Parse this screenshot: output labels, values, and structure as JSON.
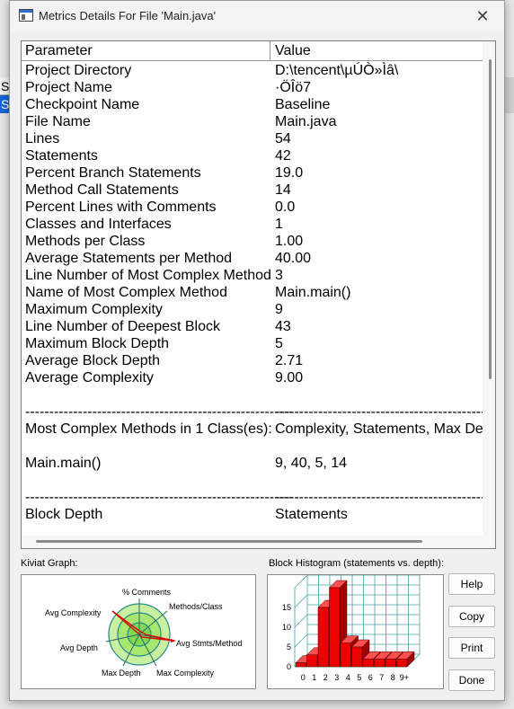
{
  "background_app": {
    "fragment_top": "Si",
    "fragment_selected": "S"
  },
  "window": {
    "title": "Metrics Details For File 'Main.java'",
    "close_glyph": "✕"
  },
  "table": {
    "headers": [
      "Parameter",
      "Value"
    ],
    "rows": [
      {
        "param": "Project Directory",
        "value": "D:\\tencent\\µÚÒ»Ìâ\\"
      },
      {
        "param": "Project Name",
        "value": "·ÖÎö7"
      },
      {
        "param": "Checkpoint Name",
        "value": "Baseline"
      },
      {
        "param": "File Name",
        "value": "Main.java"
      },
      {
        "param": "Lines",
        "value": "54"
      },
      {
        "param": "Statements",
        "value": "42"
      },
      {
        "param": "Percent Branch Statements",
        "value": "19.0"
      },
      {
        "param": "Method Call Statements",
        "value": "14"
      },
      {
        "param": "Percent Lines with Comments",
        "value": "0.0"
      },
      {
        "param": "Classes and Interfaces",
        "value": "1"
      },
      {
        "param": "Methods per Class",
        "value": "1.00"
      },
      {
        "param": "Average Statements per Method",
        "value": "40.00"
      },
      {
        "param": "Line Number of Most Complex Method",
        "value": "3"
      },
      {
        "param": "Name of Most Complex Method",
        "value": "Main.main()"
      },
      {
        "param": "Maximum Complexity",
        "value": "9"
      },
      {
        "param": "Line Number of Deepest Block",
        "value": "43"
      },
      {
        "param": "Maximum Block Depth",
        "value": "5"
      },
      {
        "param": "Average Block Depth",
        "value": "2.71"
      },
      {
        "param": "Average Complexity",
        "value": "9.00"
      },
      {
        "param": "",
        "value": ""
      },
      {
        "param": "--------------------------------------------------------",
        "value": "-------------------------------------------------------------"
      },
      {
        "param": "Most Complex Methods in 1 Class(es):",
        "value": "Complexity, Statements, Max Depth, Calls"
      },
      {
        "param": "",
        "value": ""
      },
      {
        "param": "Main.main()",
        "value": "9, 40, 5, 14"
      },
      {
        "param": "",
        "value": ""
      },
      {
        "param": "--------------------------------------------------------",
        "value": "-------------------------------------------------------------"
      },
      {
        "param": "Block Depth",
        "value": "Statements"
      }
    ]
  },
  "kiviat": {
    "label": "Kiviat Graph:",
    "axes": [
      "% Comments",
      "Methods/Class",
      "Avg Stmts/Method",
      "Max Complexity",
      "Max Depth",
      "Avg Depth",
      "Avg Complexity"
    ]
  },
  "histogram": {
    "label": "Block Histogram (statements vs. depth):",
    "y_ticks": [
      "0",
      "5",
      "10",
      "15"
    ],
    "x_labels": [
      "0",
      "1",
      "2",
      "3",
      "4",
      "5",
      "6",
      "7",
      "8",
      "9+"
    ],
    "bar_color": "#ee0000"
  },
  "chart_data": {
    "type": "bar",
    "categories": [
      "0",
      "1",
      "2",
      "3",
      "4",
      "5",
      "6",
      "7",
      "8",
      "9+"
    ],
    "values": [
      1,
      3,
      15,
      20,
      6,
      5,
      2,
      2,
      2,
      2
    ],
    "title": "Block Histogram (statements vs. depth):",
    "xlabel": "",
    "ylabel": "",
    "ylim": [
      0,
      20
    ],
    "grid": true
  },
  "buttons": {
    "help": "Help",
    "copy": "Copy",
    "print": "Print",
    "done": "Done"
  }
}
